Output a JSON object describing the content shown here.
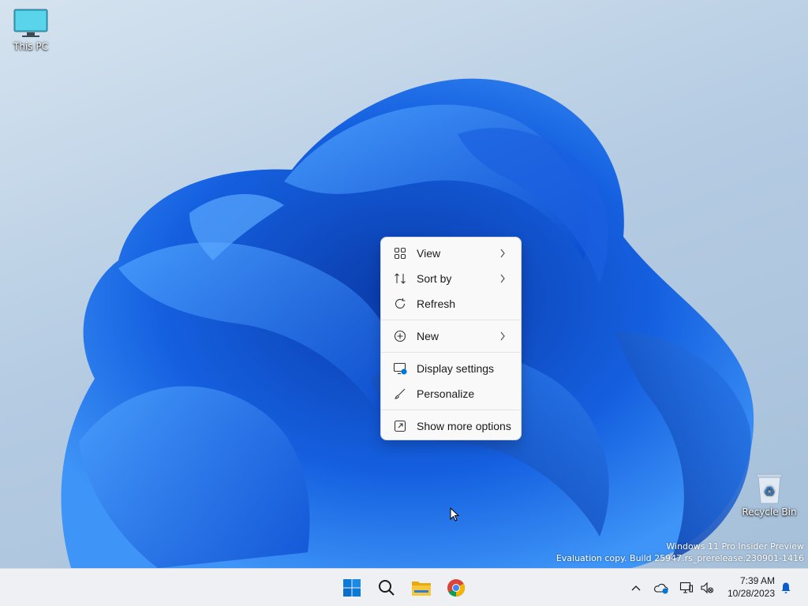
{
  "desktop": {
    "icons": [
      {
        "label": "This PC"
      },
      {
        "label": "Recycle Bin"
      }
    ],
    "watermark": {
      "line1": "Windows 11 Pro Insider Preview",
      "line2": "Evaluation copy. Build 25947.rs_prerelease.230901-1416"
    }
  },
  "context_menu": {
    "items": [
      {
        "label": "View",
        "icon": "grid-icon",
        "submenu": true
      },
      {
        "label": "Sort by",
        "icon": "sort-icon",
        "submenu": true
      },
      {
        "label": "Refresh",
        "icon": "refresh-icon",
        "submenu": false
      },
      {
        "label": "New",
        "icon": "plus-circle-icon",
        "submenu": true
      },
      {
        "label": "Display settings",
        "icon": "display-settings-icon",
        "submenu": false
      },
      {
        "label": "Personalize",
        "icon": "brush-icon",
        "submenu": false
      },
      {
        "label": "Show more options",
        "icon": "expand-icon",
        "submenu": false
      }
    ]
  },
  "taskbar": {
    "apps": [
      "start-icon",
      "search-icon",
      "file-explorer-icon",
      "chrome-icon"
    ],
    "tray": [
      "chevron-up-icon",
      "onedrive-icon",
      "network-icon",
      "volume-muted-icon",
      "bell-icon"
    ],
    "clock": {
      "time": "7:39 AM",
      "date": "10/28/2023"
    }
  },
  "colors": {
    "accent": "#0078d4",
    "bloom_dark": "#0a3fb0",
    "bloom_light": "#3b8cf5"
  }
}
